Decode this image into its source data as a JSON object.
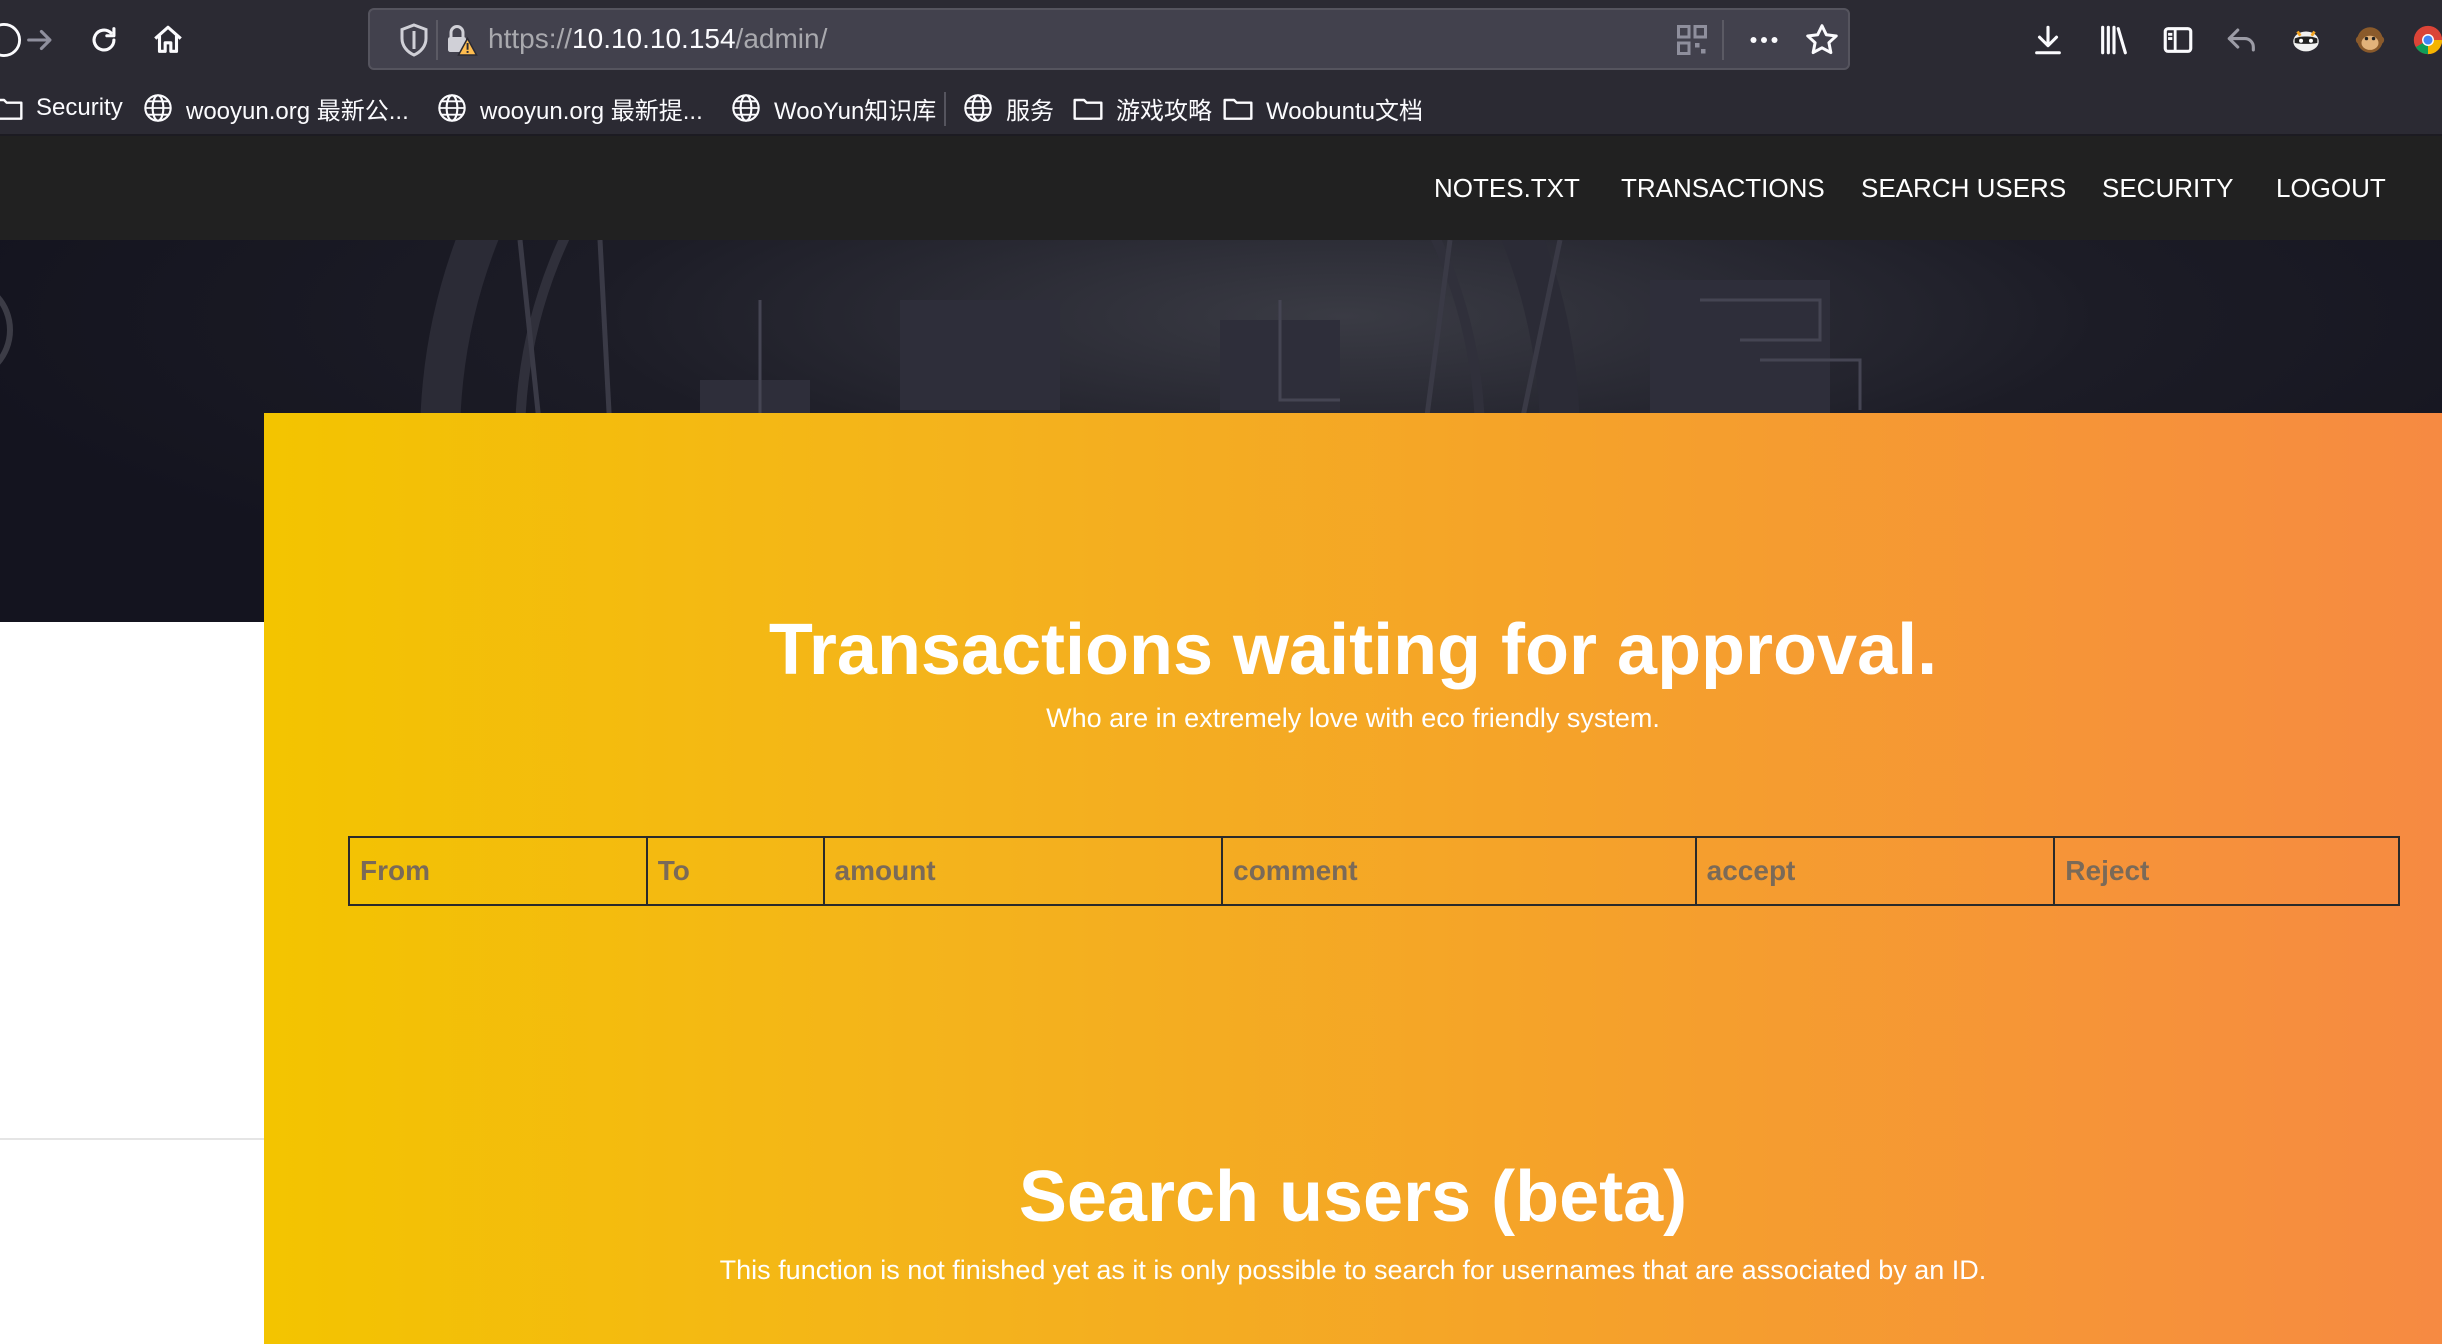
{
  "browser": {
    "url_scheme": "https://",
    "url_host": "10.10.10.154",
    "url_path": "/admin/",
    "bookmarks": [
      {
        "label": "Security",
        "icon": "folder-icon"
      },
      {
        "label": "wooyun.org 最新公...",
        "icon": "globe-icon"
      },
      {
        "label": "wooyun.org 最新提...",
        "icon": "globe-icon"
      },
      {
        "label": "WooYun知识库",
        "icon": "globe-icon"
      },
      {
        "label": "服务",
        "icon": "globe-icon"
      },
      {
        "label": "游戏攻略",
        "icon": "folder-icon"
      },
      {
        "label": "Woobuntu文档",
        "icon": "folder-icon"
      }
    ]
  },
  "nav": {
    "items": [
      "NOTES.TXT",
      "TRANSACTIONS",
      "SEARCH USERS",
      "SECURITY",
      "LOGOUT"
    ]
  },
  "transactions": {
    "title": "Transactions waiting for approval.",
    "subtitle": "Who are in extremely love with eco friendly system.",
    "columns": [
      "From",
      "To",
      "amount",
      "comment",
      "accept",
      "Reject"
    ],
    "rows": []
  },
  "search": {
    "title": "Search users (beta)",
    "subtitle": "This function is not finished yet as it is only possible to search for usernames that are associated by an ID."
  },
  "colors": {
    "panel_gradient_start": "#f3c400",
    "panel_gradient_end": "#f68a42",
    "nav_background": "#212121",
    "chrome_background": "#2b2a33"
  }
}
